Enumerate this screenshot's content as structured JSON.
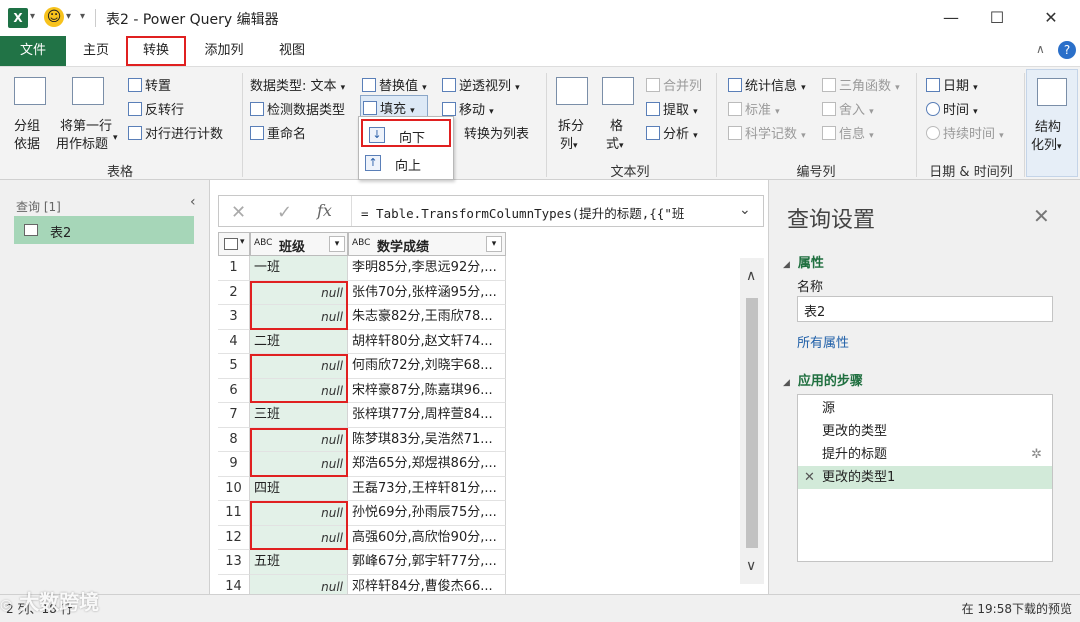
{
  "window": {
    "app_icon": "X",
    "title": "表2 - Power Query 编辑器",
    "minimize": "—",
    "maximize": "☐",
    "close": "✕"
  },
  "tabs": [
    {
      "label": "文件"
    },
    {
      "label": "主页"
    },
    {
      "label": "转换"
    },
    {
      "label": "添加列"
    },
    {
      "label": "视图"
    }
  ],
  "help": "?",
  "ribbon": {
    "table_group": {
      "group_by": "分组\n依据",
      "group_by_l1": "分组",
      "group_by_l2": "依据",
      "use_first_row_l1": "将第一行",
      "use_first_row_l2": "用作标题",
      "transpose": "转置",
      "reverse_rows": "反转行",
      "count_rows": "对行进行计数",
      "label": "表格"
    },
    "any_column_group": {
      "data_type": "数据类型: 文本",
      "detect_type": "检测数据类型",
      "rename": "重命名",
      "replace_values": "替换值",
      "fill": "填充",
      "move": "移动",
      "unpivot": "逆透视列",
      "convert_to_list": "转换为列表"
    },
    "text_column_group": {
      "split_l1": "拆分",
      "split_l2": "列",
      "format_l1": "格",
      "format_l2": "式",
      "merge": "合并列",
      "extract": "提取",
      "parse": "分析",
      "label": "文本列"
    },
    "number_column_group": {
      "statistics": "统计信息",
      "standard": "标准",
      "scientific": "科学记数",
      "trig": "三角函数",
      "rounding": "舍入",
      "information": "信息",
      "label": "编号列"
    },
    "datetime_group": {
      "date": "日期",
      "time": "时间",
      "duration": "持续时间",
      "label": "日期 & 时间列"
    },
    "structured_group": {
      "l1": "结构",
      "l2": "化列"
    }
  },
  "fill_menu": {
    "down": "向下",
    "up": "向上"
  },
  "left_pane": {
    "header": "查询 [1]",
    "query_name": "表2"
  },
  "formula_bar": {
    "text": "= Table.TransformColumnTypes(提升的标题,{{\"班"
  },
  "grid": {
    "col1_header": "班级",
    "col2_header": "数学成绩",
    "type_icon": "ABC",
    "rows": [
      {
        "n": "1",
        "c1": "一班",
        "c2": "李明85分,李思远92分,..."
      },
      {
        "n": "2",
        "c1": "null",
        "c2": "张伟70分,张梓涵95分,..."
      },
      {
        "n": "3",
        "c1": "null",
        "c2": "朱志豪82分,王雨欣78..."
      },
      {
        "n": "4",
        "c1": "二班",
        "c2": "胡梓轩80分,赵文轩74..."
      },
      {
        "n": "5",
        "c1": "null",
        "c2": "何雨欣72分,刘晓宇68..."
      },
      {
        "n": "6",
        "c1": "null",
        "c2": "宋梓豪87分,陈嘉琪96..."
      },
      {
        "n": "7",
        "c1": "三班",
        "c2": "张梓琪77分,周梓萱84..."
      },
      {
        "n": "8",
        "c1": "null",
        "c2": "陈梦琪83分,吴浩然71..."
      },
      {
        "n": "9",
        "c1": "null",
        "c2": "郑浩65分,郑煜祺86分,..."
      },
      {
        "n": "10",
        "c1": "四班",
        "c2": "王磊73分,王梓轩81分,..."
      },
      {
        "n": "11",
        "c1": "null",
        "c2": "孙悦69分,孙雨辰75分,..."
      },
      {
        "n": "12",
        "c1": "null",
        "c2": "高强60分,高欣怡90分,..."
      },
      {
        "n": "13",
        "c1": "五班",
        "c2": "郭峰67分,郭宇轩77分,..."
      },
      {
        "n": "14",
        "c1": "null",
        "c2": "邓梓轩84分,曹俊杰66..."
      }
    ]
  },
  "right_pane": {
    "title": "查询设置",
    "properties_header": "属性",
    "name_label": "名称",
    "name_value": "表2",
    "all_properties": "所有属性",
    "steps_header": "应用的步骤",
    "steps": [
      {
        "label": "源"
      },
      {
        "label": "更改的类型"
      },
      {
        "label": "提升的标题"
      },
      {
        "label": "更改的类型1"
      }
    ]
  },
  "status_bar": {
    "left": "2 列、18 行",
    "right": "在 19:58下载的预览"
  },
  "watermark": "大数跨境"
}
